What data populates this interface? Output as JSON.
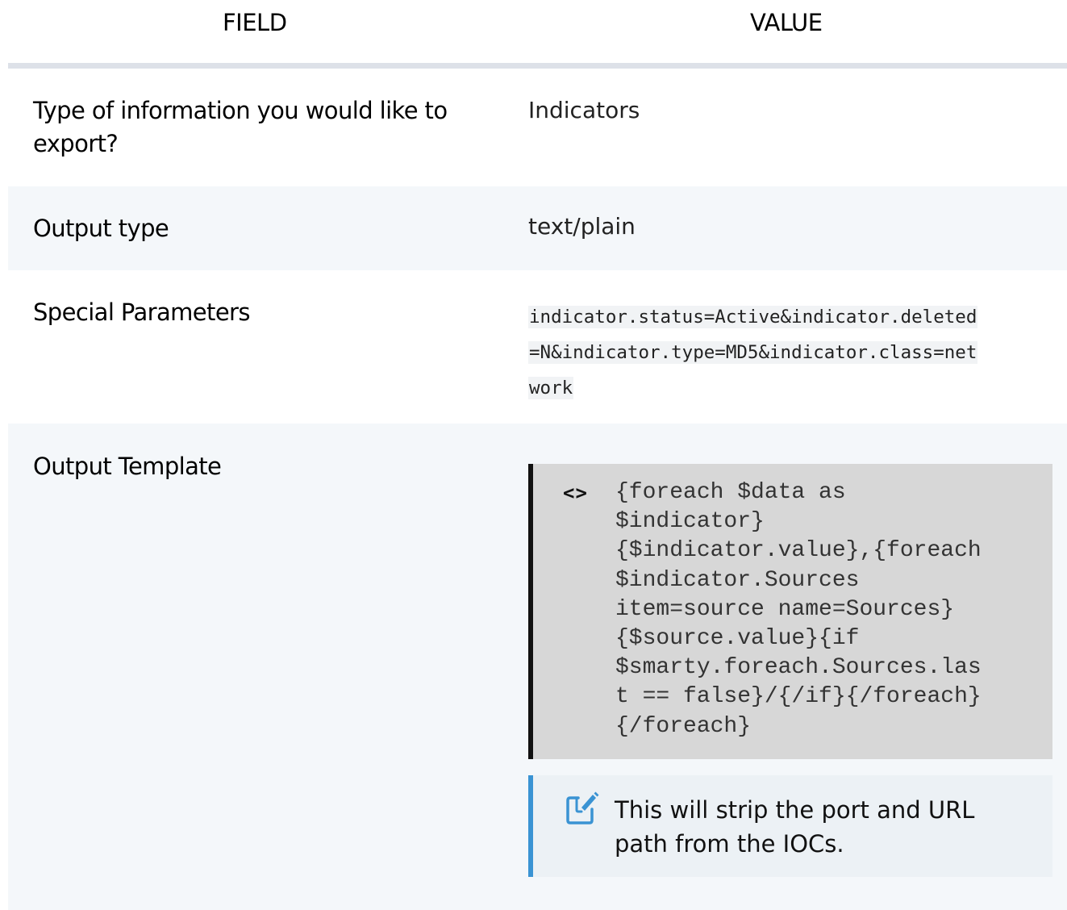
{
  "table": {
    "headers": {
      "field": "FIELD",
      "value": "VALUE"
    },
    "rows": [
      {
        "field": "Type of information you would like to export?",
        "value": "Indicators"
      },
      {
        "field": "Output type",
        "value": "text/plain"
      },
      {
        "field": "Special Parameters",
        "value_lines": [
          "indicator.status=Active&indicator.deleted",
          "=N&indicator.type=MD5&indicator.class=net",
          "work"
        ]
      },
      {
        "field": "Output Template",
        "code_icon": "<>",
        "code": "{foreach $data as\n$indicator}\n{$indicator.value},{foreach\n$indicator.Sources\nitem=source name=Sources}\n{$source.value}{if\n$smarty.foreach.Sources.las\nt == false}/{/if}{/foreach}\n{/foreach}",
        "note": {
          "icon": "note-pencil-icon",
          "text": "This will strip the port and URL path from the IOCs."
        }
      }
    ]
  },
  "colors": {
    "header_rule": "#dde1e8",
    "striped_row": "#f4f7fa",
    "code_background": "#d7d7d7",
    "code_border": "#111111",
    "note_background": "#ecf1f5",
    "note_border": "#3a93d3",
    "note_icon": "#3a93d3"
  }
}
